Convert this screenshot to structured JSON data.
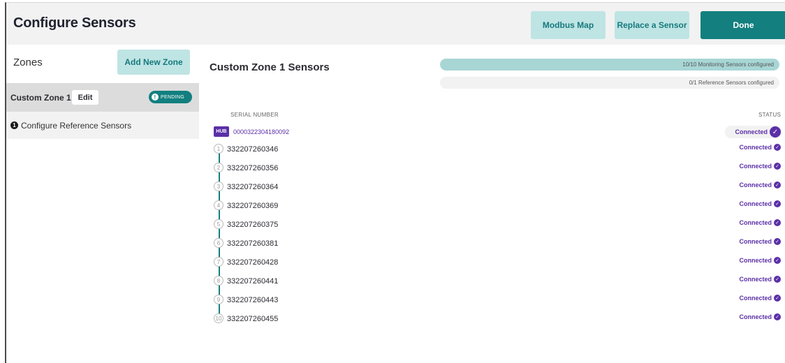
{
  "header": {
    "title": "Configure Sensors",
    "modbus_label": "Modbus Map",
    "replace_label": "Replace a Sensor",
    "done_label": "Done"
  },
  "sidebar": {
    "zones_label": "Zones",
    "add_zone_label": "Add New Zone",
    "zone": {
      "name": "Custom Zone 1",
      "edit_label": "Edit",
      "badge": "PENDING"
    },
    "reference": {
      "step": "1",
      "label": "Configure Reference Sensors"
    }
  },
  "main": {
    "title": "Custom Zone 1 Sensors",
    "monitoring_progress": {
      "text": "10/10 Monitoring Sensors configured",
      "configured": 10,
      "total": 10
    },
    "reference_progress": {
      "text": "0/1 Reference Sensors configured",
      "configured": 0,
      "total": 1
    },
    "columns": {
      "serial": "SERIAL NUMBER",
      "status": "STATUS"
    },
    "hub": {
      "badge": "HUB",
      "serial": "0000322304180092",
      "status": "Connected"
    },
    "sensors": [
      {
        "num": "1",
        "serial": "332207260346",
        "status": "Connected"
      },
      {
        "num": "2",
        "serial": "332207260356",
        "status": "Connected"
      },
      {
        "num": "3",
        "serial": "332207260364",
        "status": "Connected"
      },
      {
        "num": "4",
        "serial": "332207260369",
        "status": "Connected"
      },
      {
        "num": "5",
        "serial": "332207260375",
        "status": "Connected"
      },
      {
        "num": "6",
        "serial": "332207260381",
        "status": "Connected"
      },
      {
        "num": "7",
        "serial": "332207260428",
        "status": "Connected"
      },
      {
        "num": "8",
        "serial": "332207260441",
        "status": "Connected"
      },
      {
        "num": "9",
        "serial": "332207260443",
        "status": "Connected"
      },
      {
        "num": "10",
        "serial": "332207260455",
        "status": "Connected"
      }
    ]
  },
  "colors": {
    "teal_dark": "#137f7f",
    "teal_light": "#bfe4e4",
    "progress_fill": "#a7d6d5",
    "purple": "#5b2fa8"
  }
}
